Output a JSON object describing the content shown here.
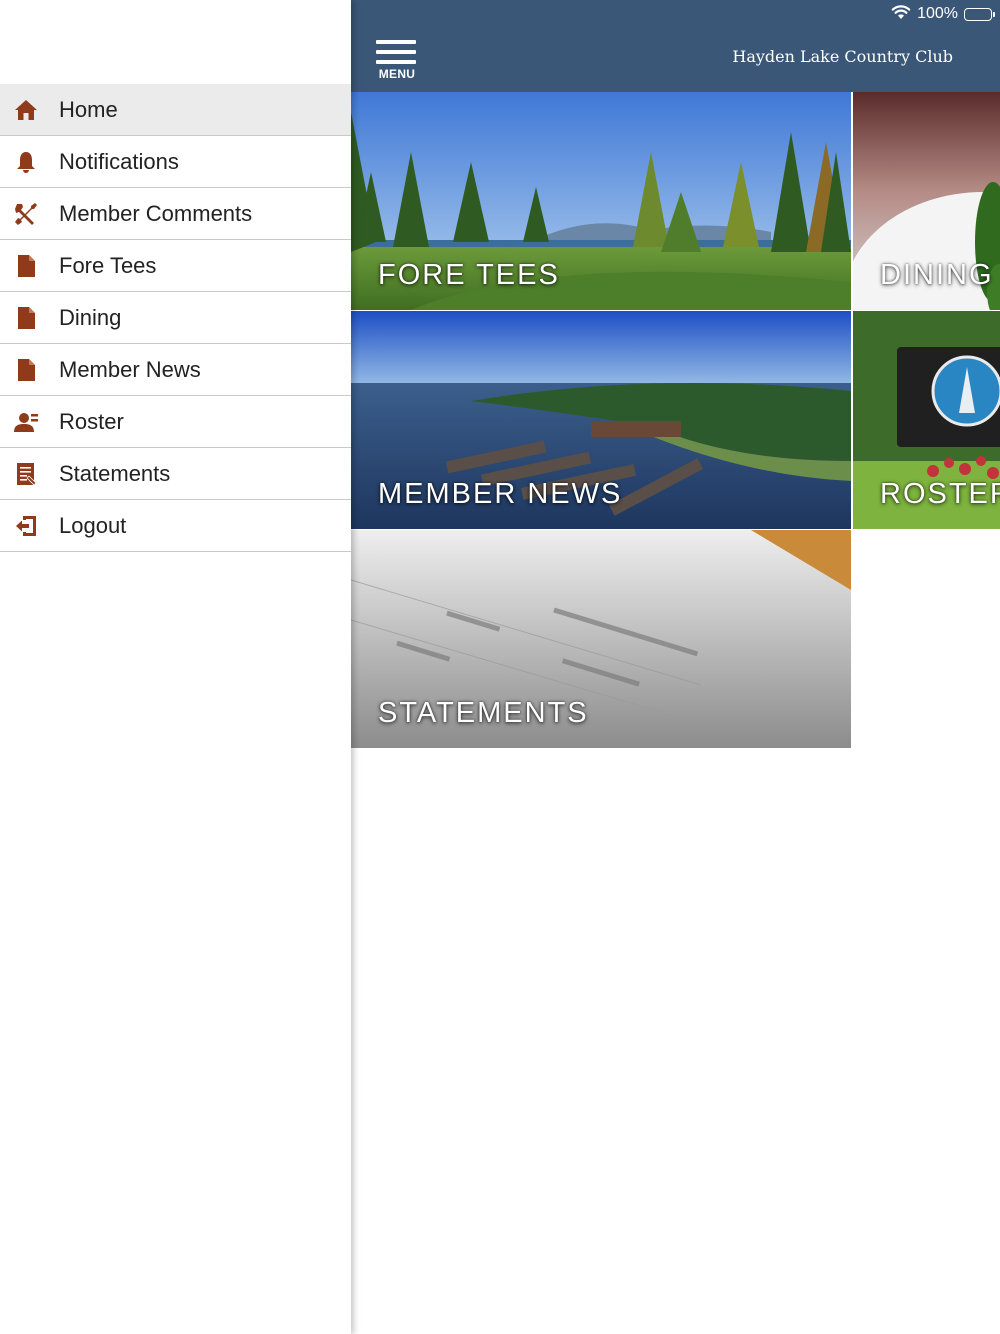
{
  "status_bar": {
    "battery_text": "100%",
    "wifi_icon": "wifi-icon",
    "battery_icon": "battery-icon"
  },
  "header": {
    "menu_label": "MENU",
    "club_name": "Hayden Lake Country Club",
    "background": "#3a5777"
  },
  "sidebar": {
    "accent": "#8f3b1b",
    "items": [
      {
        "label": "Home",
        "icon": "home-icon",
        "active": true
      },
      {
        "label": "Notifications",
        "icon": "bell-icon"
      },
      {
        "label": "Member Comments",
        "icon": "tools-icon"
      },
      {
        "label": "Fore Tees",
        "icon": "document-icon"
      },
      {
        "label": "Dining",
        "icon": "document-icon"
      },
      {
        "label": "Member News",
        "icon": "document-icon"
      },
      {
        "label": "Roster",
        "icon": "person-icon"
      },
      {
        "label": "Statements",
        "icon": "statement-icon"
      },
      {
        "label": "Logout",
        "icon": "logout-icon"
      }
    ]
  },
  "tiles": {
    "fore_tees": "FORE TEES",
    "dining": "DINING",
    "member_news": "MEMBER NEWS",
    "roster": "ROSTER",
    "statements": "STATEMENTS"
  }
}
